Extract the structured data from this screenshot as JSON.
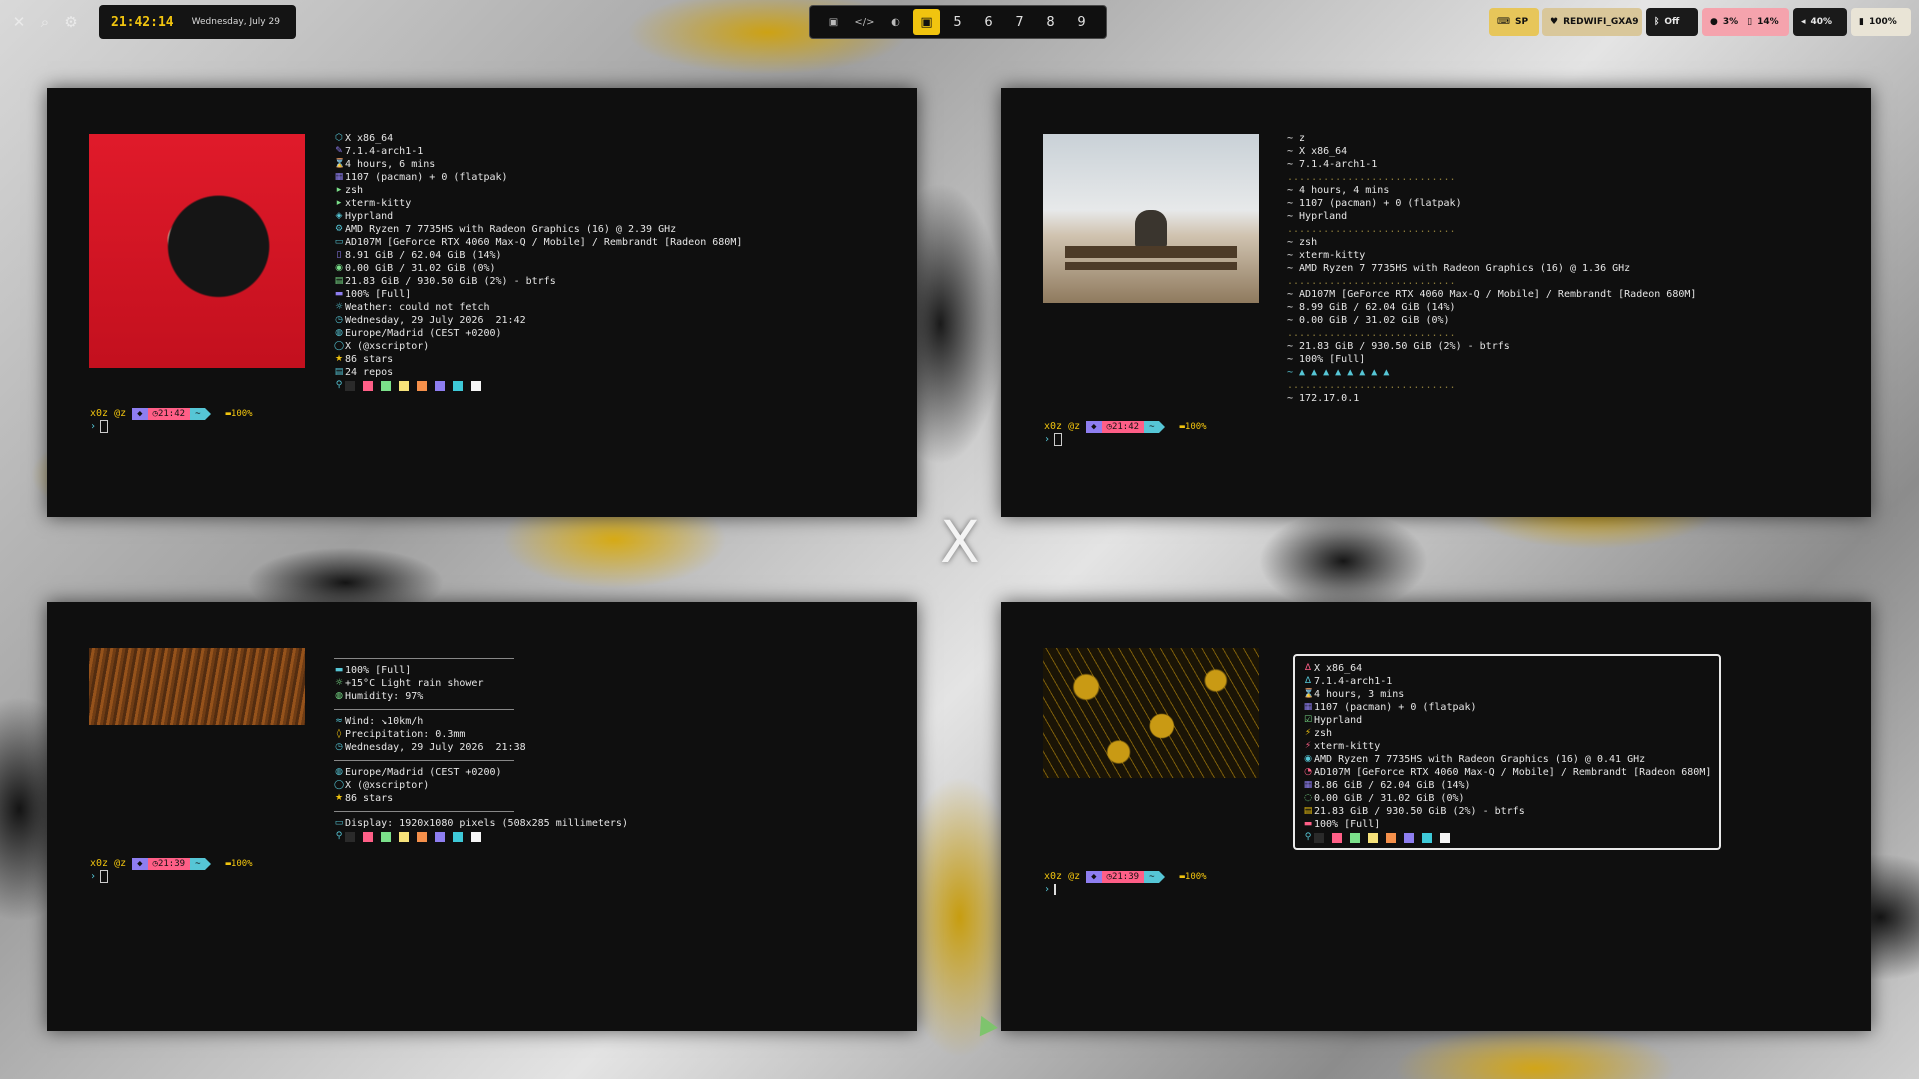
{
  "topbar": {
    "left_icons": [
      "close-icon",
      "search-icon",
      "gear-icon"
    ],
    "clock": {
      "time": "21:42:14",
      "date": "Wednesday, July 29"
    },
    "workspaces": [
      {
        "label": "▣",
        "kind": "icon",
        "icon": "window-icon"
      },
      {
        "label": "</>",
        "kind": "icon",
        "icon": "code-icon"
      },
      {
        "label": "◐",
        "kind": "icon",
        "icon": "theme-icon"
      },
      {
        "label": "▣",
        "kind": "icon",
        "icon": "active-window-icon",
        "active": true
      },
      {
        "label": "5",
        "kind": "num"
      },
      {
        "label": "6",
        "kind": "num"
      },
      {
        "label": "7",
        "kind": "num"
      },
      {
        "label": "8",
        "kind": "num"
      },
      {
        "label": "9",
        "kind": "num"
      }
    ],
    "right": {
      "keyboard": "SP",
      "wifi": "REDWIFI_GXA9",
      "bluetooth": "Off",
      "cpu": "3%",
      "mem": "14%",
      "volume": "40%",
      "battery": "100%"
    }
  },
  "term1": {
    "info": [
      {
        "icon": "⬡",
        "text": "X x86_64"
      },
      {
        "icon": "✎",
        "text": "7.1.4-arch1-1"
      },
      {
        "icon": "⌛",
        "text": "4 hours, 6 mins"
      },
      {
        "icon": "▦",
        "text": "1107 (pacman) + 0 (flatpak)"
      },
      {
        "icon": "▸",
        "text": "zsh"
      },
      {
        "icon": "▸",
        "text": "xterm-kitty"
      },
      {
        "icon": "◈",
        "text": "Hyprland"
      },
      {
        "icon": "⚙",
        "text": "AMD Ryzen 7 7735HS with Radeon Graphics (16) @ 2.39 GHz"
      },
      {
        "icon": "▭",
        "text": "AD107M [GeForce RTX 4060 Max-Q / Mobile] / Rembrandt [Radeon 680M]"
      },
      {
        "icon": "▯",
        "text": "8.91 GiB / 62.04 GiB (14%)"
      },
      {
        "icon": "◉",
        "text": "0.00 GiB / 31.02 GiB (0%)"
      },
      {
        "icon": "▤",
        "text": "21.83 GiB / 930.50 GiB (2%) - btrfs"
      },
      {
        "icon": "▬",
        "text": "100% [Full]"
      },
      {
        "icon": "☼",
        "text": "Weather: could not fetch"
      },
      {
        "icon": "◷",
        "text": "Wednesday, 29 July 2026  21:42"
      },
      {
        "icon": "◍",
        "text": "Europe/Madrid (CEST +0200)"
      },
      {
        "icon": "◯",
        "text": "X (@xscriptor)"
      },
      {
        "icon": "★",
        "text": "86 stars"
      },
      {
        "icon": "▤",
        "text": "24 repos"
      }
    ],
    "prompt": {
      "user": "x0z @z",
      "time": "21:42",
      "dir": "~",
      "battery": "100%"
    }
  },
  "term2": {
    "info": [
      "~ z",
      "~ X x86_64",
      "~ 7.1.4-arch1-1",
      "............................",
      "~ 4 hours, 4 mins",
      "~ 1107 (pacman) + 0 (flatpak)",
      "~ Hyprland",
      "............................",
      "~ zsh",
      "~ xterm-kitty",
      "~ AMD Ryzen 7 7735HS with Radeon Graphics (16) @ 1.36 GHz",
      "............................",
      "~ AD107M [GeForce RTX 4060 Max-Q / Mobile] / Rembrandt [Radeon 680M]",
      "~ 8.99 GiB / 62.04 GiB (14%)",
      "~ 0.00 GiB / 31.02 GiB (0%)",
      "............................",
      "~ 21.83 GiB / 930.50 GiB (2%) - btrfs",
      "~ 100% [Full]",
      "~ ▲ ▲ ▲ ▲ ▲ ▲ ▲ ▲",
      "............................",
      "~ 172.17.0.1"
    ],
    "prompt": {
      "user": "x0z @z",
      "time": "21:42",
      "dir": "~",
      "battery": "100%"
    }
  },
  "term3": {
    "info": [
      {
        "icon": "▬",
        "text": "100% [Full]"
      },
      {
        "icon": "☼",
        "text": "+15°C Light rain shower"
      },
      {
        "icon": "◍",
        "text": "Humidity: 97%"
      },
      {
        "icon": "≈",
        "text": "Wind: ↘10km/h"
      },
      {
        "icon": "◊",
        "text": "Precipitation: 0.3mm"
      },
      {
        "icon": "◷",
        "text": "Wednesday, 29 July 2026  21:38"
      },
      {
        "icon": "◍",
        "text": "Europe/Madrid (CEST +0200)"
      },
      {
        "icon": "◯",
        "text": "X (@xscriptor)"
      },
      {
        "icon": "★",
        "text": "86 stars"
      },
      {
        "icon": "▭",
        "text": "Display: 1920x1080 pixels (508x285 millimeters)"
      }
    ],
    "prompt": {
      "user": "x0z @z",
      "time": "21:39",
      "dir": "~",
      "battery": "100%"
    }
  },
  "term4": {
    "info": [
      {
        "icon": "Δ",
        "text": "X x86_64"
      },
      {
        "icon": "Δ",
        "text": "7.1.4-arch1-1"
      },
      {
        "icon": "⌛",
        "text": "4 hours, 3 mins"
      },
      {
        "icon": "▦",
        "text": "1107 (pacman) + 0 (flatpak)"
      },
      {
        "icon": "☑",
        "text": "Hyprland"
      },
      {
        "icon": "⚡",
        "text": "zsh"
      },
      {
        "icon": "⚡",
        "text": "xterm-kitty"
      },
      {
        "icon": "◉",
        "text": "AMD Ryzen 7 7735HS with Radeon Graphics (16) @ 0.41 GHz"
      },
      {
        "icon": "◔",
        "text": "AD107M [GeForce RTX 4060 Max-Q / Mobile] / Rembrandt [Radeon 680M]"
      },
      {
        "icon": "▦",
        "text": "8.86 GiB / 62.04 GiB (14%)"
      },
      {
        "icon": "◌",
        "text": "0.00 GiB / 31.02 GiB (0%)"
      },
      {
        "icon": "▤",
        "text": "21.83 GiB / 930.50 GiB (2%) - btrfs"
      },
      {
        "icon": "▬",
        "text": "100% [Full]"
      }
    ],
    "prompt": {
      "user": "x0z @z",
      "time": "21:39",
      "dir": "~",
      "battery": "100%"
    }
  },
  "palette": [
    "#2a2a2a",
    "#ff5f87",
    "#7be08a",
    "#f6e27a",
    "#f5904b",
    "#8e7ef0",
    "#3ec9d8",
    "#f5f5f5"
  ],
  "desktop_mark": "X",
  "colors": {
    "accent": "#f1c40f",
    "terminal_bg": "#0f0f0f",
    "pink": "#ff5f87",
    "cyan": "#56c6d6",
    "purple": "#8e7ef0"
  }
}
